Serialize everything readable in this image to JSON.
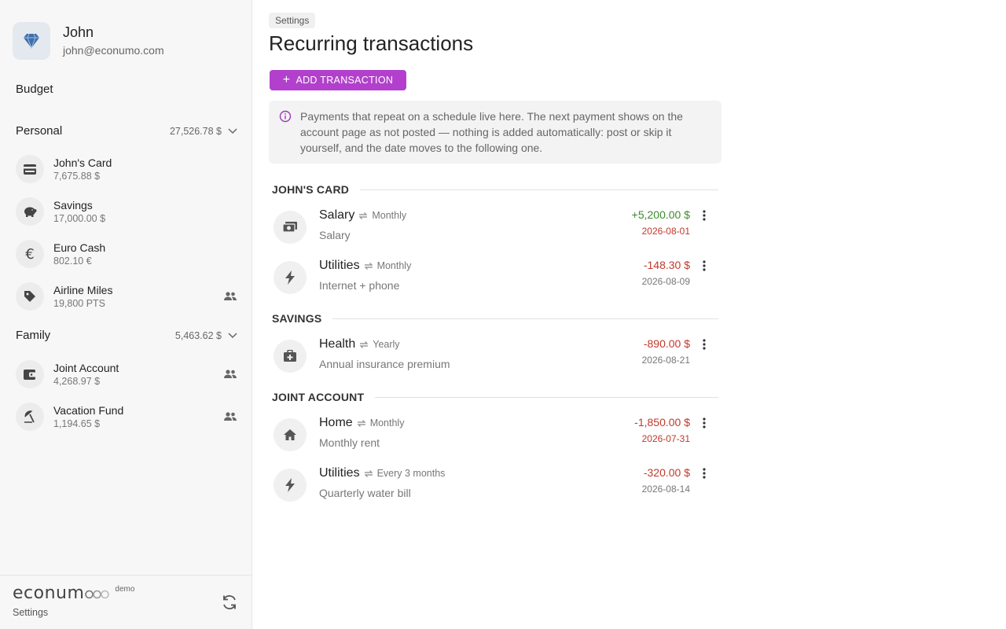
{
  "user": {
    "name": "John",
    "email": "john@econumo.com",
    "avatar_icon": "diamond-icon"
  },
  "sidebar": {
    "budget_label": "Budget",
    "folders": [
      {
        "name": "Personal",
        "total": "27,526.78 $",
        "accounts": [
          {
            "name": "John's Card",
            "balance": "7,675.88 $",
            "icon": "card-icon",
            "shared": false
          },
          {
            "name": "Savings",
            "balance": "17,000.00 $",
            "icon": "piggy-bank-icon",
            "shared": false
          },
          {
            "name": "Euro Cash",
            "balance": "802.10 €",
            "icon": "euro-icon",
            "shared": false
          },
          {
            "name": "Airline Miles",
            "balance": "19,800 PTS",
            "icon": "tag-icon",
            "shared": true
          }
        ]
      },
      {
        "name": "Family",
        "total": "5,463.62 $",
        "accounts": [
          {
            "name": "Joint Account",
            "balance": "4,268.97 $",
            "icon": "wallet-icon",
            "shared": true
          },
          {
            "name": "Vacation Fund",
            "balance": "1,194.65 $",
            "icon": "beach-umbrella-icon",
            "shared": true
          }
        ]
      }
    ],
    "logo_text": "econum",
    "logo_demo": "demo",
    "settings_label": "Settings"
  },
  "main": {
    "breadcrumb": "Settings",
    "title": "Recurring transactions",
    "add_button": "ADD TRANSACTION",
    "info_line1": "Payments that repeat on a schedule live here. The next payment shows on the",
    "info_line2": "account page as not posted — nothing is added automatically: post or skip it",
    "info_line3": "yourself, and the date moves to the following one.",
    "sections": [
      {
        "name": "JOHN'S CARD",
        "transactions": [
          {
            "name": "Salary",
            "period": "Monthly",
            "description": "Salary",
            "amount": "+5,200.00 $",
            "date": "2026-08-01",
            "icon": "money-icon"
          },
          {
            "name": "Utilities",
            "period": "Monthly",
            "description": "Internet + phone",
            "amount": "-148.30 $",
            "date": "2026-08-09",
            "icon": "lightning-icon"
          }
        ]
      },
      {
        "name": "SAVINGS",
        "transactions": [
          {
            "name": "Health",
            "period": "Yearly",
            "description": "Annual insurance premium",
            "amount": "-890.00 $",
            "date": "2026-08-21",
            "icon": "medical-kit-icon"
          }
        ]
      },
      {
        "name": "JOINT ACCOUNT",
        "transactions": [
          {
            "name": "Home",
            "period": "Monthly",
            "description": "Monthly rent",
            "amount": "-1,850.00 $",
            "date": "2026-07-31",
            "icon": "home-icon"
          },
          {
            "name": "Utilities",
            "period": "Every 3 months",
            "description": "Quarterly water bill",
            "amount": "-320.00 $",
            "date": "2026-08-14",
            "icon": "lightning-icon"
          }
        ]
      }
    ]
  },
  "colors": {
    "accent": "#b240cc",
    "positive": "#3c8a2e",
    "negative": "#c0392b"
  }
}
